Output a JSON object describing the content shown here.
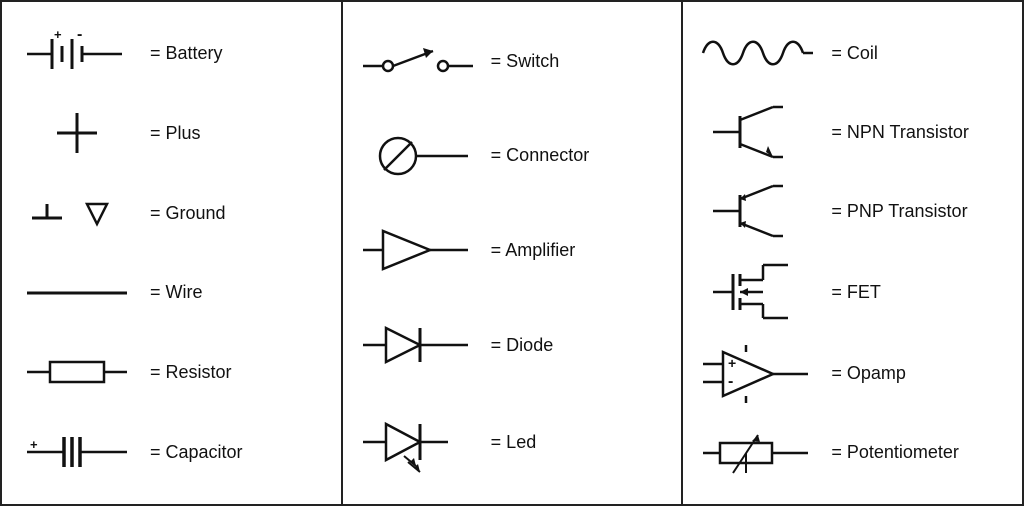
{
  "col1": {
    "items": [
      {
        "name": "battery",
        "label": "= Battery"
      },
      {
        "name": "plus",
        "label": "= Plus"
      },
      {
        "name": "ground",
        "label": "= Ground"
      },
      {
        "name": "wire",
        "label": "= Wire"
      },
      {
        "name": "resistor",
        "label": "= Resistor"
      },
      {
        "name": "capacitor",
        "label": "= Capacitor"
      }
    ]
  },
  "col2": {
    "items": [
      {
        "name": "switch",
        "label": "= Switch"
      },
      {
        "name": "connector",
        "label": "= Connector"
      },
      {
        "name": "amplifier",
        "label": "= Amplifier"
      },
      {
        "name": "diode",
        "label": "= Diode"
      },
      {
        "name": "led",
        "label": "= Led"
      }
    ]
  },
  "col3": {
    "items": [
      {
        "name": "coil",
        "label": "= Coil"
      },
      {
        "name": "npn-transistor",
        "label": "= NPN Transistor"
      },
      {
        "name": "pnp-transistor",
        "label": "= PNP Transistor"
      },
      {
        "name": "fet",
        "label": "= FET"
      },
      {
        "name": "opamp",
        "label": "= Opamp"
      },
      {
        "name": "potentiometer",
        "label": "= Potentiometer"
      }
    ]
  }
}
